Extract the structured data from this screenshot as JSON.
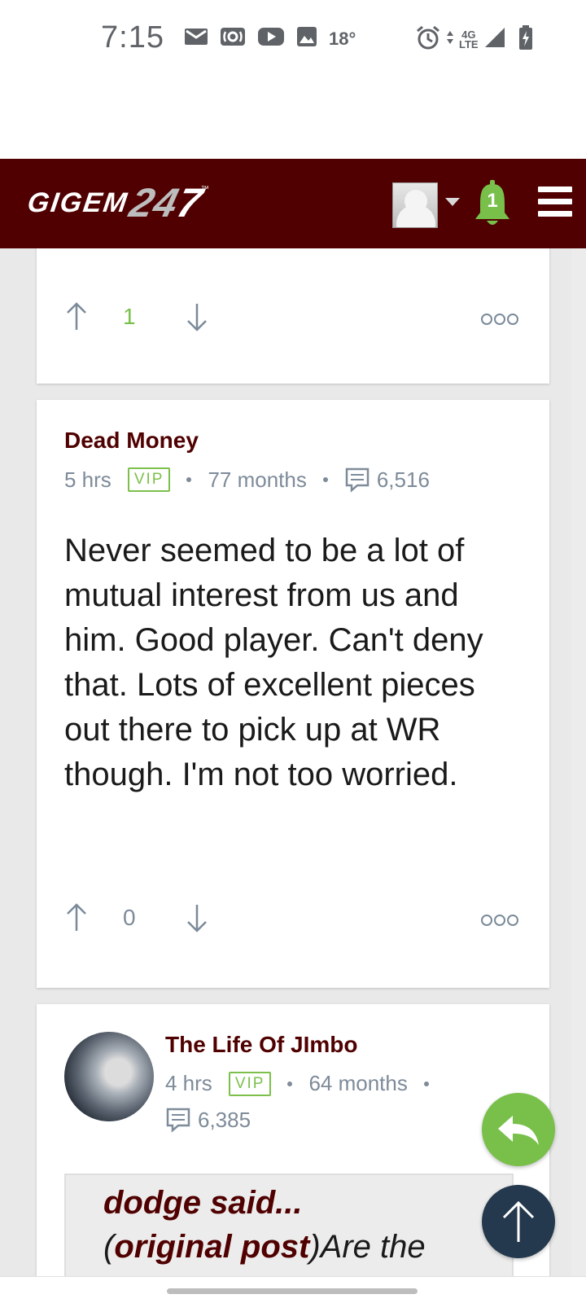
{
  "status_bar": {
    "time": "7:15",
    "temperature": "18°",
    "network_top": "4G",
    "network_bottom": "LTE",
    "icons_left": [
      "mail-icon",
      "radio-icon",
      "youtube-icon",
      "image-icon"
    ],
    "icons_right": [
      "alarm-icon",
      "signal-icon",
      "battery-charging-icon"
    ]
  },
  "header": {
    "logo_part1": "GIGEM",
    "logo_part2": "24",
    "logo_part3": "7",
    "logo_tm": "™",
    "notification_count": "1",
    "colors": {
      "brand": "#500000",
      "accent_green": "#78c04a"
    }
  },
  "posts": [
    {
      "votes": "1",
      "vote_color": "#78c04a"
    },
    {
      "author": "Dead Money",
      "time": "5 hrs",
      "badge": "VIP",
      "tenure": "77 months",
      "post_count": "6,516",
      "body": "Never seemed to be a lot of mutual interest from us and him. Good player. Can't deny that. Lots of excellent pieces out there to pick up at WR though. I'm not too worried.",
      "votes": "0"
    },
    {
      "author": "The Life Of JImbo",
      "time": "4 hrs",
      "badge": "VIP",
      "tenure": "64 months",
      "post_count": "6,385",
      "quote": {
        "said": "dodge said...",
        "open_paren": "(",
        "original_post": "original post",
        "close_paren": ")",
        "text": "Are the"
      }
    }
  ]
}
